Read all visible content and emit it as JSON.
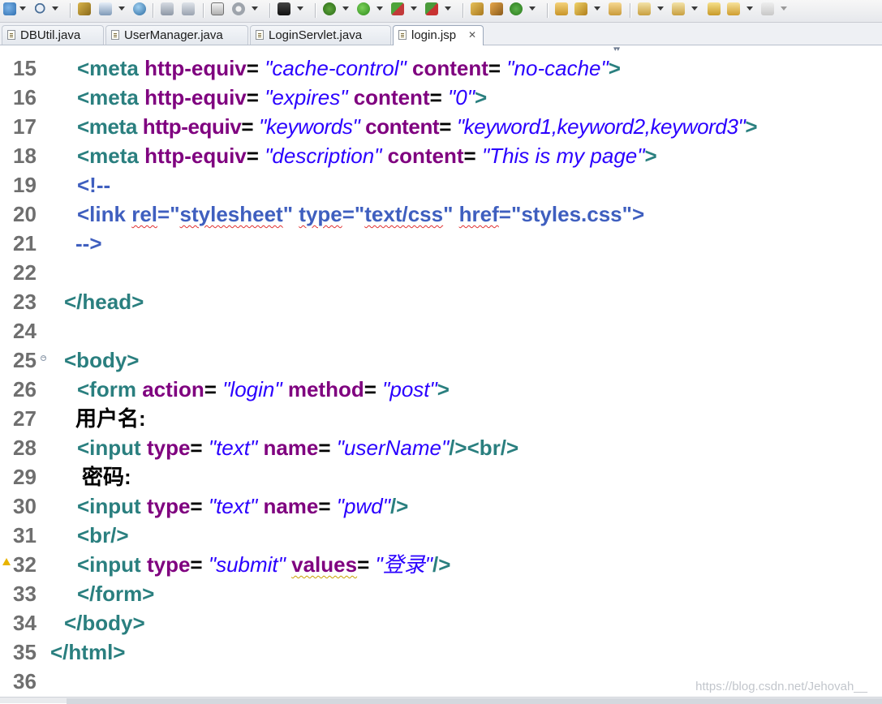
{
  "toolbar": {
    "icons": [
      "new-wizard-icon",
      "search-icon",
      "open-type-icon",
      "open-resource-icon",
      "web-browser-icon",
      "save-icon",
      "save-all-icon",
      "new-server-icon",
      "gear-icon",
      "monitor-icon",
      "debug-icon",
      "run-icon",
      "coverage-icon",
      "external-tools-icon",
      "new-java-project-icon",
      "new-package-icon",
      "new-class-icon",
      "open-folder-icon",
      "pen-icon",
      "open-task-icon",
      "next-annotation-icon",
      "prev-annotation-icon",
      "last-edit-icon",
      "back-icon",
      "forward-icon"
    ]
  },
  "tabs": [
    {
      "label": "DBUtil.java",
      "active": false
    },
    {
      "label": "UserManager.java",
      "active": false
    },
    {
      "label": "LoginServlet.java",
      "active": false
    },
    {
      "label": "login.jsp",
      "active": true,
      "close": "✕"
    }
  ],
  "editor": {
    "lines": [
      {
        "n": "15"
      },
      {
        "n": "16"
      },
      {
        "n": "17"
      },
      {
        "n": "18"
      },
      {
        "n": "19"
      },
      {
        "n": "20"
      },
      {
        "n": "21"
      },
      {
        "n": "22"
      },
      {
        "n": "23"
      },
      {
        "n": "24"
      },
      {
        "n": "25"
      },
      {
        "n": "26"
      },
      {
        "n": "27"
      },
      {
        "n": "28"
      },
      {
        "n": "29"
      },
      {
        "n": "30"
      },
      {
        "n": "31"
      },
      {
        "n": "32"
      },
      {
        "n": "33"
      },
      {
        "n": "34"
      },
      {
        "n": "35"
      },
      {
        "n": "36"
      }
    ],
    "code": {
      "l15": {
        "open": "<meta",
        "a1": "http-equiv",
        "v1": "\"cache-control\"",
        "a2": "content",
        "v2": "\"no-cache\"",
        "close": ">"
      },
      "l16": {
        "open": "<meta",
        "a1": "http-equiv",
        "v1": "\"expires\"",
        "a2": "content",
        "v2": "\"0\"",
        "close": ">"
      },
      "l17": {
        "open": "<meta",
        "a1": "http-equiv",
        "v1": "\"keywords\"",
        "a2": "content",
        "v2": "\"keyword1,keyword2,keyword3\"",
        "close": ">"
      },
      "l18": {
        "open": "<meta",
        "a1": "http-equiv",
        "v1": "\"description\"",
        "a2": "content",
        "v2": "\"This is my page\"",
        "close": ">"
      },
      "l19": {
        "text": "<!--"
      },
      "l20": {
        "p1": "<link ",
        "rel": "rel",
        "p2": "=\"",
        "stylesheet": "stylesheet",
        "p3": "\" ",
        "type": "type",
        "p4": "=\"",
        "textcss": "text/css",
        "p5": "\" ",
        "href": "href",
        "p6": "=\"",
        "styles": "styles.css",
        "p7": "\">"
      },
      "l21": {
        "text": "-->"
      },
      "l23": {
        "text": "</head>"
      },
      "l25": {
        "text": "<body>"
      },
      "l26": {
        "open": "<form",
        "a1": "action",
        "v1": "\"login\"",
        "a2": "method",
        "v2": "\"post\"",
        "close": ">"
      },
      "l27": {
        "text": "用户名:"
      },
      "l28": {
        "open": "<input",
        "a1": "type",
        "v1": "\"text\"",
        "a2": "name",
        "v2": "\"userName\"",
        "close": "/>",
        "br": "<br/>"
      },
      "l29": {
        "text": "密码:"
      },
      "l30": {
        "open": "<input",
        "a1": "type",
        "v1": "\"text\"",
        "a2": "name",
        "v2": "\"pwd\"",
        "close": "/>"
      },
      "l31": {
        "text": "<br/>"
      },
      "l32": {
        "open": "<input",
        "a1": "type",
        "v1": "\"submit\"",
        "a2": "values",
        "v2": "\"登录\"",
        "close": "/>"
      },
      "l33": {
        "text": "</form>"
      },
      "l34": {
        "text": "</body>"
      },
      "l35": {
        "text": "</html>"
      }
    },
    "eq": "="
  },
  "watermark": "https://blog.csdn.net/Jehovah__",
  "colors": {
    "tag": "#2a7f7f",
    "attribute": "#7f007f",
    "value": "#2a00ff",
    "comment": "#3f5fbf",
    "line_number": "#6f6f6f"
  }
}
